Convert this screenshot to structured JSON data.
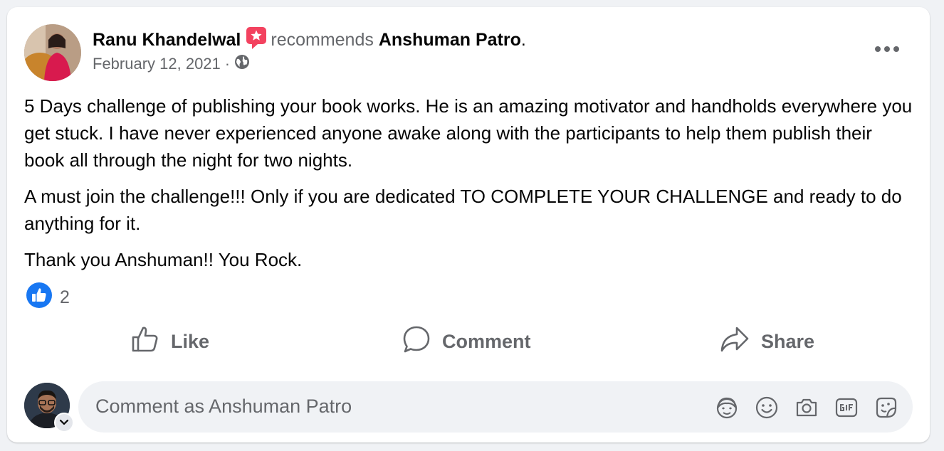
{
  "post": {
    "author": "Ranu Khandelwal",
    "verb": "recommends",
    "target": "Anshuman Patro",
    "period": ".",
    "date": "February 12, 2021",
    "dot": "·",
    "audience_icon": "globe-icon",
    "recommend_badge_icon": "star-badge-icon",
    "paragraphs": [
      "5 Days challenge of publishing your book works. He is an amazing motivator and handholds everywhere you get stuck. I have never experienced anyone awake along with the participants to help them publish their book all through the night for two nights.",
      "A must join the challenge!!! Only if you are dedicated TO COMPLETE YOUR CHALLENGE and ready to do anything for it.",
      "Thank you Anshuman!! You Rock."
    ],
    "reaction_count": "2"
  },
  "actions": {
    "like": "Like",
    "comment": "Comment",
    "share": "Share"
  },
  "composer": {
    "placeholder": "Comment as Anshuman Patro",
    "icons": [
      "avatar-sticker-icon",
      "emoji-icon",
      "camera-icon",
      "gif-icon",
      "sticker-icon"
    ]
  },
  "colors": {
    "like_blue": "#1877f2",
    "badge_pink": "#f3425f",
    "muted": "#65676b"
  }
}
